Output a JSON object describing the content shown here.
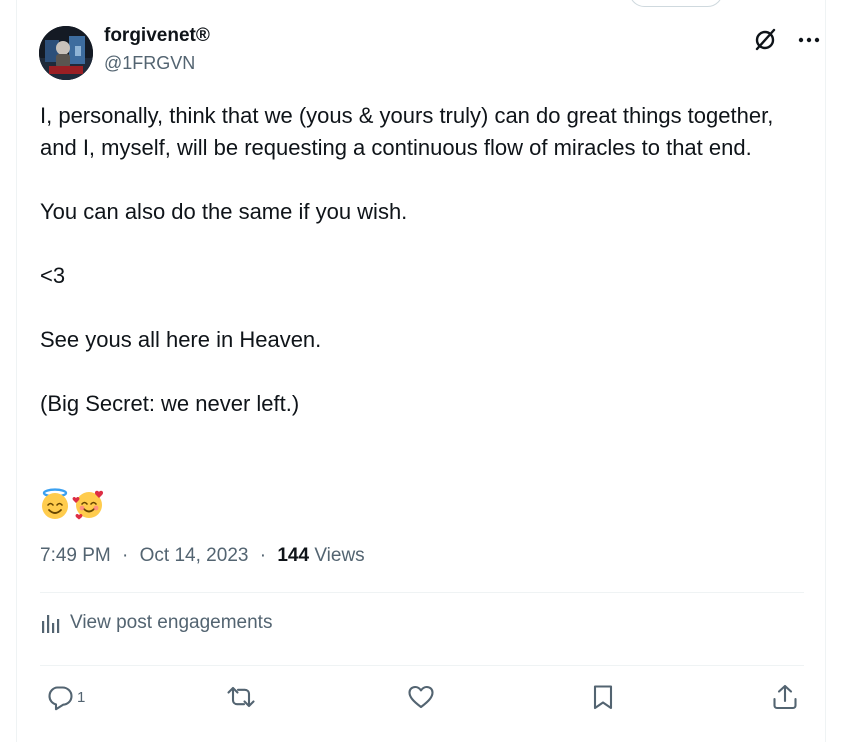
{
  "author": {
    "display_name": "forgivenet®",
    "handle": "@1FRGVN",
    "avatar_icon": "avatar-photo"
  },
  "header": {
    "grok_icon": "grok-slashed-circle-icon",
    "more_icon": "more-dots-icon"
  },
  "post": {
    "paragraphs": [
      "I, personally, think that we (yous & yours truly) can do great things together, and I, myself, will be requesting a continuous flow of miracles to that end.",
      "You can also do the same if you wish.",
      "<3",
      "See yous all here in Heaven.",
      "(Big Secret: we never left.)"
    ],
    "emojis": [
      "smiling-face-with-halo-emoji",
      "smiling-face-with-hearts-emoji"
    ]
  },
  "meta": {
    "time": "7:49 PM",
    "separator": "·",
    "date": "Oct 14, 2023",
    "views_count": "144",
    "views_label": "Views"
  },
  "engagements": {
    "label": "View post engagements",
    "icon": "bar-chart-icon"
  },
  "actions": {
    "reply_count": "1",
    "reply_icon": "reply-icon",
    "repost_icon": "repost-icon",
    "like_icon": "like-heart-icon",
    "bookmark_icon": "bookmark-icon",
    "share_icon": "share-icon"
  },
  "colors": {
    "text_primary": "#0f1419",
    "text_secondary": "#536471",
    "divider": "#eff3f4"
  }
}
